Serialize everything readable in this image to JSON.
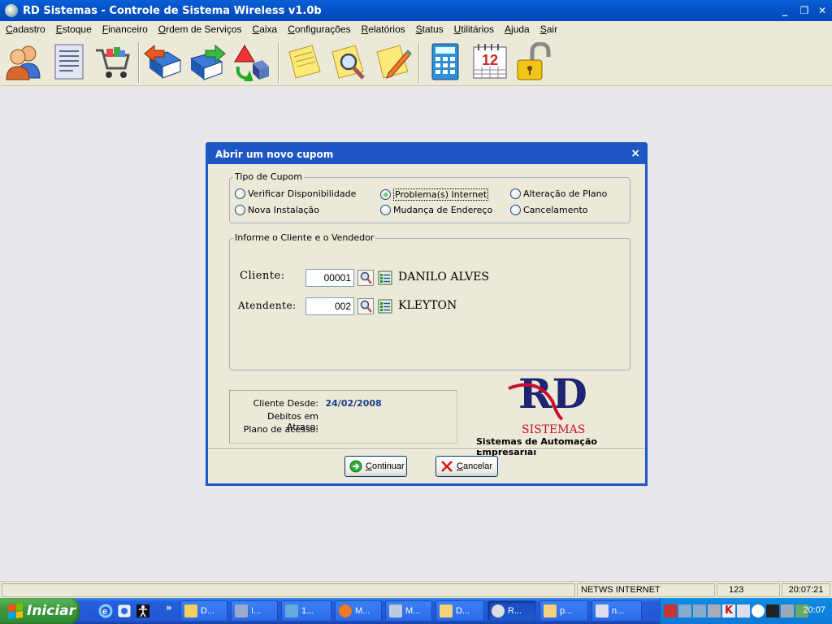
{
  "window": {
    "title": "RD Sistemas - Controle de Sistema Wireless v1.0b",
    "controls": [
      "minimize-icon",
      "restore-icon",
      "close-icon"
    ]
  },
  "menu": {
    "items": [
      "Cadastro",
      "Estoque",
      "Financeiro",
      "Ordem de Serviços",
      "Caixa",
      "Configurações",
      "Relatórios",
      "Status",
      "Utilitários",
      "Ajuda",
      "Sair"
    ]
  },
  "toolbar": {
    "icons": [
      "users-icon",
      "document-list-icon",
      "shopping-cart-icon",
      "book-back-icon",
      "book-forward-icon",
      "shapes-icon",
      "note-icon",
      "note-search-icon",
      "note-edit-icon",
      "calculator-icon",
      "calendar-icon",
      "padlock-icon"
    ],
    "calendar_day": "12"
  },
  "dialog": {
    "title": "Abrir um novo cupom",
    "close": "×",
    "tipo_cupom": {
      "legend": "Tipo de Cupom",
      "options": [
        {
          "label": "Verificar Disponibilidade",
          "selected": false
        },
        {
          "label": "Problema(s) Internet",
          "selected": true
        },
        {
          "label": "Alteração de Plano",
          "selected": false
        },
        {
          "label": "Nova Instalação",
          "selected": false
        },
        {
          "label": "Mudança de Endereço",
          "selected": false
        },
        {
          "label": "Cancelamento",
          "selected": false
        }
      ]
    },
    "cliente_vendedor": {
      "legend": "Informe o Cliente e o Vendedor",
      "cliente_label": "Cliente:",
      "cliente_code": "00001",
      "cliente_name": "DANILO ALVES",
      "atendente_label": "Atendente:",
      "atendente_code": "002",
      "atendente_name": "KLEYTON"
    },
    "info": {
      "cliente_desde_label": "Cliente Desde:",
      "cliente_desde_value": "24/02/2008",
      "debitos_label": "Debitos em Atraso:",
      "plano_label": "Plano de acesso:"
    },
    "logo": {
      "letters": "RD",
      "brand": "SISTEMAS",
      "subtitle": "Sistemas de Automação Empresarial"
    },
    "buttons": {
      "continuar": "Continuar",
      "cancelar": "Cancelar"
    }
  },
  "statusbar": {
    "company": "NETWS INTERNET",
    "code": "123",
    "time": "20:07:21"
  },
  "taskbar": {
    "start": "Iniciar",
    "quick_launch": [
      "ie-icon",
      "media-icon",
      "accessibility-icon"
    ],
    "expand": "»",
    "tasks": [
      "D...",
      "I...",
      "1...",
      "M...",
      "M...",
      "D...",
      "R...",
      "p...",
      "n..."
    ],
    "clock": "20:07"
  },
  "colors": {
    "title_blue": "#0453c7",
    "accent_navy": "#1e57c4",
    "logo_red": "#c8102e",
    "logo_navy": "#1c2473"
  }
}
